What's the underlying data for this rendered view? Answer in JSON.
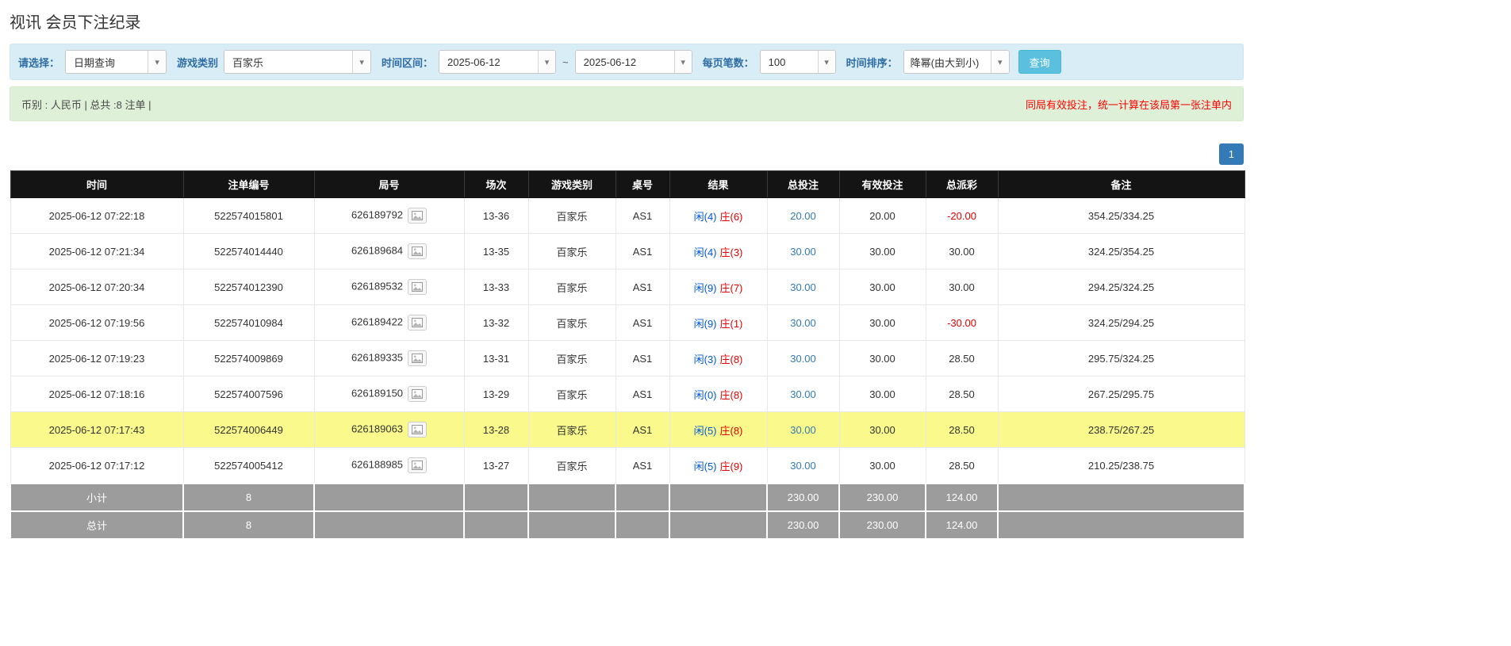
{
  "page": {
    "title": "视讯 会员下注纪录"
  },
  "icons": {
    "caret": "▾"
  },
  "filters": {
    "select_label": "请选择：",
    "select_value": "日期查询",
    "game_type_label": "游戏类别",
    "game_type_value": "百家乐",
    "date_range_label": "时间区间：",
    "date_from": "2025-06-12",
    "date_separator": "~",
    "date_to": "2025-06-12",
    "per_page_label": "每页笔数：",
    "per_page_value": "100",
    "sort_label": "时间排序：",
    "sort_value": "降幂(由大到小)",
    "search_button": "查询"
  },
  "summary": {
    "left": "币别 : 人民币 | 总共 :8 注单 |",
    "right": "同局有效投注，统一计算在该局第一张注单内"
  },
  "pagination": {
    "current_page": "1"
  },
  "colors": {
    "accent_blue": "#337ab7",
    "search_button_cyan": "#5bc0de",
    "filter_bar_bg": "#d9edf7",
    "summary_bar_bg": "#dff0d8",
    "warning_red": "#ff0000",
    "player_blue": "#0057d8",
    "banker_red": "#e60000",
    "highlight_yellow": "#f9f98c",
    "footer_gray": "#9c9c9c",
    "header_black": "#141414"
  },
  "table": {
    "headers": [
      "时间",
      "注单编号",
      "局号",
      "场次",
      "游戏类别",
      "桌号",
      "结果",
      "总投注",
      "有效投注",
      "总派彩",
      "备注"
    ],
    "rows": [
      {
        "time": "2025-06-12 07:22:18",
        "bet_id": "522574015801",
        "round_id": "626189792",
        "session": "13-36",
        "game": "百家乐",
        "table_no": "AS1",
        "result_player": "闲(4)",
        "result_banker": "庄(6)",
        "total_bet": "20.00",
        "valid_bet": "20.00",
        "payout": "-20.00",
        "remark": "354.25/334.25",
        "highlight": false
      },
      {
        "time": "2025-06-12 07:21:34",
        "bet_id": "522574014440",
        "round_id": "626189684",
        "session": "13-35",
        "game": "百家乐",
        "table_no": "AS1",
        "result_player": "闲(4)",
        "result_banker": "庄(3)",
        "total_bet": "30.00",
        "valid_bet": "30.00",
        "payout": "30.00",
        "remark": "324.25/354.25",
        "highlight": false
      },
      {
        "time": "2025-06-12 07:20:34",
        "bet_id": "522574012390",
        "round_id": "626189532",
        "session": "13-33",
        "game": "百家乐",
        "table_no": "AS1",
        "result_player": "闲(9)",
        "result_banker": "庄(7)",
        "total_bet": "30.00",
        "valid_bet": "30.00",
        "payout": "30.00",
        "remark": "294.25/324.25",
        "highlight": false
      },
      {
        "time": "2025-06-12 07:19:56",
        "bet_id": "522574010984",
        "round_id": "626189422",
        "session": "13-32",
        "game": "百家乐",
        "table_no": "AS1",
        "result_player": "闲(9)",
        "result_banker": "庄(1)",
        "total_bet": "30.00",
        "valid_bet": "30.00",
        "payout": "-30.00",
        "remark": "324.25/294.25",
        "highlight": false
      },
      {
        "time": "2025-06-12 07:19:23",
        "bet_id": "522574009869",
        "round_id": "626189335",
        "session": "13-31",
        "game": "百家乐",
        "table_no": "AS1",
        "result_player": "闲(3)",
        "result_banker": "庄(8)",
        "total_bet": "30.00",
        "valid_bet": "30.00",
        "payout": "28.50",
        "remark": "295.75/324.25",
        "highlight": false
      },
      {
        "time": "2025-06-12 07:18:16",
        "bet_id": "522574007596",
        "round_id": "626189150",
        "session": "13-29",
        "game": "百家乐",
        "table_no": "AS1",
        "result_player": "闲(0)",
        "result_banker": "庄(8)",
        "total_bet": "30.00",
        "valid_bet": "30.00",
        "payout": "28.50",
        "remark": "267.25/295.75",
        "highlight": false
      },
      {
        "time": "2025-06-12 07:17:43",
        "bet_id": "522574006449",
        "round_id": "626189063",
        "session": "13-28",
        "game": "百家乐",
        "table_no": "AS1",
        "result_player": "闲(5)",
        "result_banker": "庄(8)",
        "total_bet": "30.00",
        "valid_bet": "30.00",
        "payout": "28.50",
        "remark": "238.75/267.25",
        "highlight": true
      },
      {
        "time": "2025-06-12 07:17:12",
        "bet_id": "522574005412",
        "round_id": "626188985",
        "session": "13-27",
        "game": "百家乐",
        "table_no": "AS1",
        "result_player": "闲(5)",
        "result_banker": "庄(9)",
        "total_bet": "30.00",
        "valid_bet": "30.00",
        "payout": "28.50",
        "remark": "210.25/238.75",
        "highlight": false
      }
    ],
    "subtotal": {
      "label": "小计",
      "count": "8",
      "total_bet": "230.00",
      "valid_bet": "230.00",
      "payout": "124.00"
    },
    "total": {
      "label": "总计",
      "count": "8",
      "total_bet": "230.00",
      "valid_bet": "230.00",
      "payout": "124.00"
    }
  }
}
